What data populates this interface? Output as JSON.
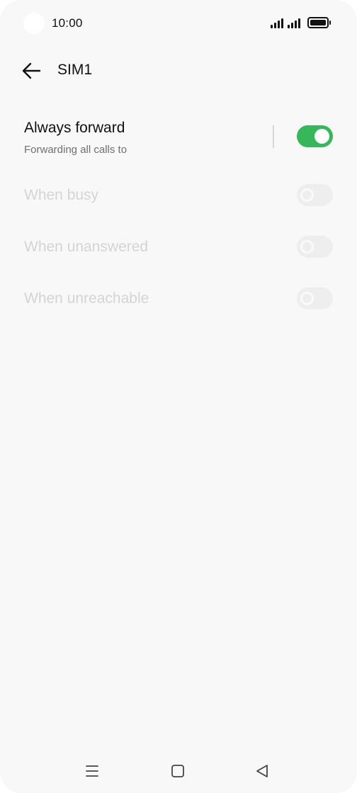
{
  "status_bar": {
    "time": "10:00",
    "icons": [
      "signal-icon",
      "signal-icon",
      "battery-icon"
    ]
  },
  "header": {
    "title": "SIM1",
    "back_icon": "arrow-left-icon"
  },
  "settings": {
    "always_forward": {
      "title": "Always forward",
      "subtitle": "Forwarding all calls to",
      "enabled": true
    },
    "when_busy": {
      "title": "When busy",
      "enabled": false
    },
    "when_unanswered": {
      "title": "When unanswered",
      "enabled": false
    },
    "when_unreachable": {
      "title": "When unreachable",
      "enabled": false
    }
  },
  "nav_bar": {
    "icons": [
      "menu-icon",
      "home-icon",
      "back-triangle-icon"
    ]
  },
  "colors": {
    "accent": "#35b75a",
    "background": "#f8f8f8",
    "disabled_text": "#d4d4d4"
  }
}
